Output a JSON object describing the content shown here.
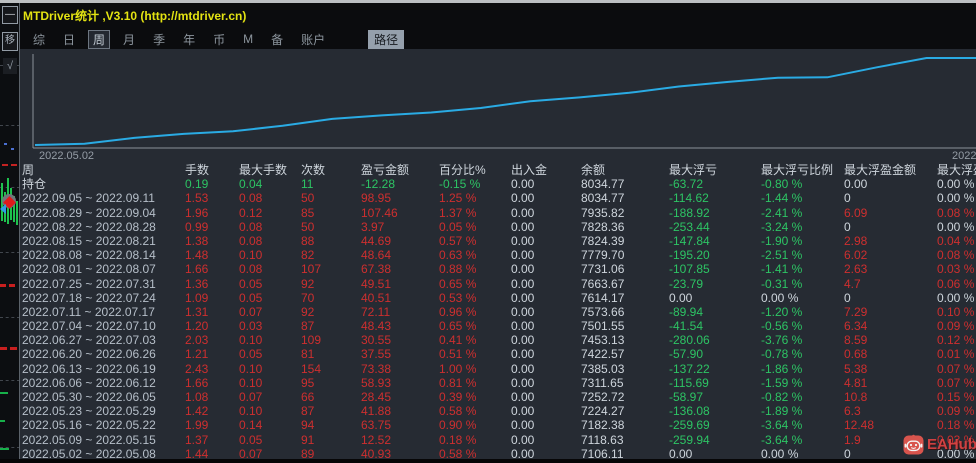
{
  "window": {
    "title": "MTDriver统计 ,V3.10 (http://mtdriver.cn)"
  },
  "sidebar": {
    "minimize_label": "—",
    "move_label": "移",
    "check_label": "√"
  },
  "menu": {
    "items": [
      {
        "label": "综",
        "active": false
      },
      {
        "label": "日",
        "active": false
      },
      {
        "label": "周",
        "active": true
      },
      {
        "label": "月",
        "active": false
      },
      {
        "label": "季",
        "active": false
      },
      {
        "label": "年",
        "active": false
      },
      {
        "label": "币",
        "active": false
      },
      {
        "label": "M",
        "active": false
      },
      {
        "label": "备",
        "active": false
      },
      {
        "label": "账户",
        "active": false
      }
    ],
    "path_button": "路径"
  },
  "chart_data": {
    "type": "line",
    "x_start_label": "2022.05.02",
    "x_end_label": "2022",
    "legend": "余额",
    "line_color": "#2aabe4",
    "ylim": [
      7106.11,
      8034.77
    ],
    "series": [
      {
        "name": "余额",
        "x": [
          "2022.05.08",
          "2022.05.15",
          "2022.05.22",
          "2022.05.29",
          "2022.06.05",
          "2022.06.12",
          "2022.06.19",
          "2022.06.26",
          "2022.07.03",
          "2022.07.10",
          "2022.07.17",
          "2022.07.24",
          "2022.07.31",
          "2022.08.07",
          "2022.08.14",
          "2022.08.21",
          "2022.08.28",
          "2022.09.04",
          "2022.09.11",
          "持仓"
        ],
        "values": [
          7106.11,
          7118.63,
          7182.38,
          7224.27,
          7252.72,
          7311.65,
          7385.03,
          7422.57,
          7453.13,
          7501.55,
          7573.66,
          7614.17,
          7663.67,
          7731.06,
          7779.7,
          7824.39,
          7828.36,
          7935.82,
          8034.77,
          8034.77
        ]
      }
    ]
  },
  "table": {
    "columns": [
      "周",
      "手数",
      "最大手数",
      "次数",
      "盈亏金额",
      "百分比%",
      "出入金",
      "余额",
      "最大浮亏",
      "最大浮亏比例",
      "最大浮盈金额",
      "最大浮盈比例"
    ],
    "rows": [
      {
        "cells": [
          "持仓",
          "0.19",
          "0.04",
          "11",
          "-12.28",
          "-0.15 %",
          "0.00",
          "8034.77",
          "-63.72",
          "-0.80 %",
          "0.00",
          "0.00 %"
        ],
        "colors": [
          "w",
          "g",
          "g",
          "g",
          "g",
          "g",
          "w",
          "w",
          "g",
          "g",
          "w",
          "w"
        ]
      },
      {
        "cells": [
          "2022.09.05 ~ 2022.09.11",
          "1.53",
          "0.08",
          "50",
          "98.95",
          "1.25 %",
          "0.00",
          "8034.77",
          "-114.62",
          "-1.44 %",
          "0",
          "0.00 %"
        ],
        "colors": [
          "d",
          "r",
          "r",
          "r",
          "r",
          "r",
          "w",
          "w",
          "g",
          "g",
          "w",
          "w"
        ]
      },
      {
        "cells": [
          "2022.08.29 ~ 2022.09.04",
          "1.96",
          "0.12",
          "85",
          "107.46",
          "1.37 %",
          "0.00",
          "7935.82",
          "-188.92",
          "-2.41 %",
          "6.09",
          "0.08 %"
        ],
        "colors": [
          "d",
          "r",
          "r",
          "r",
          "r",
          "r",
          "w",
          "w",
          "g",
          "g",
          "r",
          "r"
        ]
      },
      {
        "cells": [
          "2022.08.22 ~ 2022.08.28",
          "0.99",
          "0.08",
          "50",
          "3.97",
          "0.05 %",
          "0.00",
          "7828.36",
          "-253.44",
          "-3.24 %",
          "0",
          "0.00 %"
        ],
        "colors": [
          "d",
          "r",
          "r",
          "r",
          "r",
          "r",
          "w",
          "w",
          "g",
          "g",
          "w",
          "w"
        ]
      },
      {
        "cells": [
          "2022.08.15 ~ 2022.08.21",
          "1.38",
          "0.08",
          "88",
          "44.69",
          "0.57 %",
          "0.00",
          "7824.39",
          "-147.84",
          "-1.90 %",
          "2.98",
          "0.04 %"
        ],
        "colors": [
          "d",
          "r",
          "r",
          "r",
          "r",
          "r",
          "w",
          "w",
          "g",
          "g",
          "r",
          "r"
        ]
      },
      {
        "cells": [
          "2022.08.08 ~ 2022.08.14",
          "1.48",
          "0.10",
          "82",
          "48.64",
          "0.63 %",
          "0.00",
          "7779.70",
          "-195.20",
          "-2.51 %",
          "6.02",
          "0.08 %"
        ],
        "colors": [
          "d",
          "r",
          "r",
          "r",
          "r",
          "r",
          "w",
          "w",
          "g",
          "g",
          "r",
          "r"
        ]
      },
      {
        "cells": [
          "2022.08.01 ~ 2022.08.07",
          "1.66",
          "0.08",
          "107",
          "67.38",
          "0.88 %",
          "0.00",
          "7731.06",
          "-107.85",
          "-1.41 %",
          "2.63",
          "0.03 %"
        ],
        "colors": [
          "d",
          "r",
          "r",
          "r",
          "r",
          "r",
          "w",
          "w",
          "g",
          "g",
          "r",
          "r"
        ]
      },
      {
        "cells": [
          "2022.07.25 ~ 2022.07.31",
          "1.36",
          "0.05",
          "92",
          "49.51",
          "0.65 %",
          "0.00",
          "7663.67",
          "-23.79",
          "-0.31 %",
          "4.7",
          "0.06 %"
        ],
        "colors": [
          "d",
          "r",
          "r",
          "r",
          "r",
          "r",
          "w",
          "w",
          "g",
          "g",
          "r",
          "r"
        ]
      },
      {
        "cells": [
          "2022.07.18 ~ 2022.07.24",
          "1.09",
          "0.05",
          "70",
          "40.51",
          "0.53 %",
          "0.00",
          "7614.17",
          "0.00",
          "0.00 %",
          "0",
          "0.00 %"
        ],
        "colors": [
          "d",
          "r",
          "r",
          "r",
          "r",
          "r",
          "w",
          "w",
          "w",
          "w",
          "w",
          "w"
        ]
      },
      {
        "cells": [
          "2022.07.11 ~ 2022.07.17",
          "1.31",
          "0.07",
          "92",
          "72.11",
          "0.96 %",
          "0.00",
          "7573.66",
          "-89.94",
          "-1.20 %",
          "7.29",
          "0.10 %"
        ],
        "colors": [
          "d",
          "r",
          "r",
          "r",
          "r",
          "r",
          "w",
          "w",
          "g",
          "g",
          "r",
          "r"
        ]
      },
      {
        "cells": [
          "2022.07.04 ~ 2022.07.10",
          "1.20",
          "0.03",
          "87",
          "48.43",
          "0.65 %",
          "0.00",
          "7501.55",
          "-41.54",
          "-0.56 %",
          "6.34",
          "0.09 %"
        ],
        "colors": [
          "d",
          "r",
          "r",
          "r",
          "r",
          "r",
          "w",
          "w",
          "g",
          "g",
          "r",
          "r"
        ]
      },
      {
        "cells": [
          "2022.06.27 ~ 2022.07.03",
          "2.03",
          "0.10",
          "109",
          "30.55",
          "0.41 %",
          "0.00",
          "7453.13",
          "-280.06",
          "-3.76 %",
          "8.59",
          "0.12 %"
        ],
        "colors": [
          "d",
          "r",
          "r",
          "r",
          "r",
          "r",
          "w",
          "w",
          "g",
          "g",
          "r",
          "r"
        ]
      },
      {
        "cells": [
          "2022.06.20 ~ 2022.06.26",
          "1.21",
          "0.05",
          "81",
          "37.55",
          "0.51 %",
          "0.00",
          "7422.57",
          "-57.90",
          "-0.78 %",
          "0.68",
          "0.01 %"
        ],
        "colors": [
          "d",
          "r",
          "r",
          "r",
          "r",
          "r",
          "w",
          "w",
          "g",
          "g",
          "r",
          "r"
        ]
      },
      {
        "cells": [
          "2022.06.13 ~ 2022.06.19",
          "2.43",
          "0.10",
          "154",
          "73.38",
          "1.00 %",
          "0.00",
          "7385.03",
          "-137.22",
          "-1.86 %",
          "5.38",
          "0.07 %"
        ],
        "colors": [
          "d",
          "r",
          "r",
          "r",
          "r",
          "r",
          "w",
          "w",
          "g",
          "g",
          "r",
          "r"
        ]
      },
      {
        "cells": [
          "2022.06.06 ~ 2022.06.12",
          "1.66",
          "0.10",
          "95",
          "58.93",
          "0.81 %",
          "0.00",
          "7311.65",
          "-115.69",
          "-1.59 %",
          "4.81",
          "0.07 %"
        ],
        "colors": [
          "d",
          "r",
          "r",
          "r",
          "r",
          "r",
          "w",
          "w",
          "g",
          "g",
          "r",
          "r"
        ]
      },
      {
        "cells": [
          "2022.05.30 ~ 2022.06.05",
          "1.08",
          "0.07",
          "66",
          "28.45",
          "0.39 %",
          "0.00",
          "7252.72",
          "-58.97",
          "-0.82 %",
          "10.8",
          "0.15 %"
        ],
        "colors": [
          "d",
          "r",
          "r",
          "r",
          "r",
          "r",
          "w",
          "w",
          "g",
          "g",
          "r",
          "r"
        ]
      },
      {
        "cells": [
          "2022.05.23 ~ 2022.05.29",
          "1.42",
          "0.10",
          "87",
          "41.88",
          "0.58 %",
          "0.00",
          "7224.27",
          "-136.08",
          "-1.89 %",
          "6.3",
          "0.09 %"
        ],
        "colors": [
          "d",
          "r",
          "r",
          "r",
          "r",
          "r",
          "w",
          "w",
          "g",
          "g",
          "r",
          "r"
        ]
      },
      {
        "cells": [
          "2022.05.16 ~ 2022.05.22",
          "1.99",
          "0.14",
          "94",
          "63.75",
          "0.90 %",
          "0.00",
          "7182.38",
          "-259.69",
          "-3.64 %",
          "12.48",
          "0.18 %"
        ],
        "colors": [
          "d",
          "r",
          "r",
          "r",
          "r",
          "r",
          "w",
          "w",
          "g",
          "g",
          "r",
          "r"
        ]
      },
      {
        "cells": [
          "2022.05.09 ~ 2022.05.15",
          "1.37",
          "0.05",
          "91",
          "12.52",
          "0.18 %",
          "0.00",
          "7118.63",
          "-259.94",
          "-3.64 %",
          "1.9",
          "0.03 %"
        ],
        "colors": [
          "d",
          "r",
          "r",
          "r",
          "r",
          "r",
          "w",
          "w",
          "g",
          "g",
          "r",
          "r"
        ]
      },
      {
        "cells": [
          "2022.05.02 ~ 2022.05.08",
          "1.44",
          "0.07",
          "89",
          "40.93",
          "0.58 %",
          "0.00",
          "7106.11",
          "0.00",
          "0.00 %",
          "0",
          "0.00 %"
        ],
        "colors": [
          "d",
          "r",
          "r",
          "r",
          "r",
          "r",
          "w",
          "w",
          "w",
          "w",
          "w",
          "w"
        ]
      }
    ]
  },
  "watermark": {
    "text": "EAHub"
  }
}
